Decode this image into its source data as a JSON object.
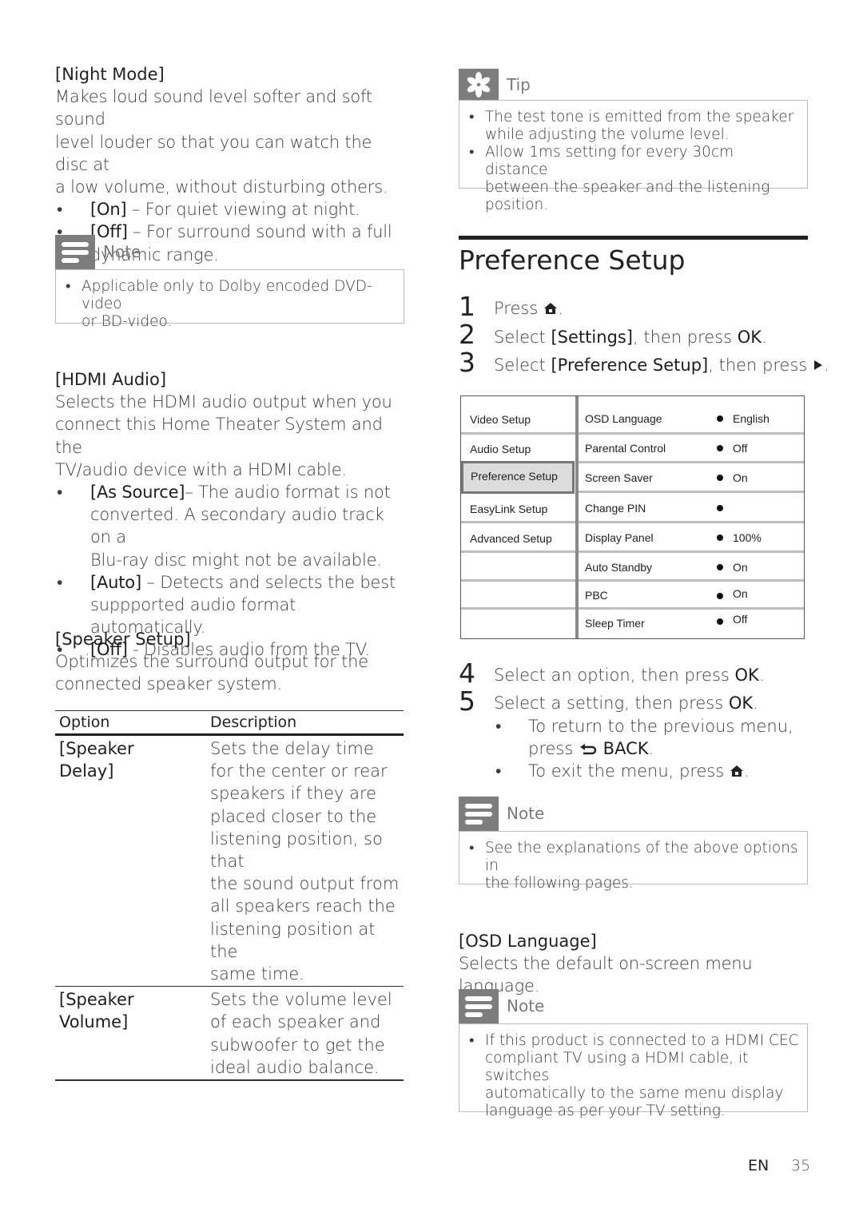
{
  "left_column": {
    "night_mode": {
      "heading": "[Night Mode]",
      "description_lines": [
        "Makes loud sound level softer and soft sound",
        "level louder so that you can watch the disc at",
        "a low volume, without disturbing others."
      ],
      "options": [
        {
          "label": "[On]",
          "text_lines": [
            " – For quiet viewing at night."
          ]
        },
        {
          "label": "[Off]",
          "text_lines": [
            " – For surround sound with a full",
            "dynamic range."
          ]
        }
      ]
    },
    "note_1": {
      "tag": "Note",
      "icon": "note-lines-icon",
      "items": [
        {
          "lines": [
            "Applicable only to Dolby encoded DVD-video",
            "or BD-video."
          ]
        }
      ]
    },
    "hdmi_audio": {
      "heading": "[HDMI Audio]",
      "description_lines": [
        "Selects the HDMI audio output when you",
        "connect this Home Theater System and the",
        "TV/audio device with a HDMI cable."
      ],
      "options": [
        {
          "label": "[As Source]",
          "text_lines": [
            "– The audio format is not",
            "converted. A secondary audio track on a",
            "Blu-ray disc might not be available."
          ]
        },
        {
          "label": "[Auto]",
          "text_lines": [
            " – Detects and selects the best",
            "suppported audio format automatically."
          ]
        },
        {
          "label": "[Off]",
          "text_lines": [
            " - Disables audio from the TV."
          ]
        }
      ]
    },
    "speaker_setup": {
      "heading": "[Speaker Setup]",
      "description_lines": [
        "Optimizes the surround output for the",
        "connected speaker system."
      ],
      "table": {
        "headers": [
          "Option",
          "Description"
        ],
        "rows": [
          {
            "option_lines": [
              "[Speaker",
              "Delay]"
            ],
            "description_lines": [
              "Sets the delay time",
              "for the center or rear",
              "speakers if they are",
              "placed closer to the",
              "listening position, so that",
              "the sound output from",
              "all speakers reach the",
              "listening position at the",
              "same time."
            ]
          },
          {
            "option_lines": [
              "[Speaker",
              "Volume]"
            ],
            "description_lines": [
              "Sets the volume level",
              "of each speaker and",
              "subwoofer to get the",
              "ideal audio balance."
            ]
          }
        ]
      }
    }
  },
  "right_column": {
    "tip": {
      "tag": "Tip",
      "icon": "asterisk-tip-icon",
      "items": [
        {
          "lines": [
            "The test tone is emitted from the speaker",
            "while adjusting the volume level."
          ]
        },
        {
          "lines": [
            "Allow 1ms setting for every 30cm distance",
            "between the speaker and the listening position."
          ]
        }
      ]
    },
    "section_title": "Preference Setup",
    "steps_a": [
      {
        "num": "1",
        "pre": "Press ",
        "icon": "home-icon",
        "bold": "",
        "post": "."
      },
      {
        "num": "2",
        "pre": "Select ",
        "bold": "[Settings]",
        "post": ", then press ",
        "bold2": "OK",
        "post2": "."
      },
      {
        "num": "3",
        "pre": "Select ",
        "bold": "[Preference Setup]",
        "post": ", then press ",
        "icon": "play-right-icon",
        "post2": "."
      }
    ],
    "osd_menu": {
      "left_items": [
        "Video Setup",
        "Audio Setup",
        "Preference Setup",
        "EasyLink Setup",
        "Advanced Setup",
        "",
        "",
        ""
      ],
      "selected_left_index": 2,
      "settings": [
        {
          "name": "OSD Language",
          "value": "English"
        },
        {
          "name": "Parental Control",
          "value": "Off"
        },
        {
          "name": "Screen Saver",
          "value": "On"
        },
        {
          "name": "Change PIN",
          "value": ""
        },
        {
          "name": "Display Panel",
          "value": "100%"
        },
        {
          "name": "Auto Standby",
          "value": "On"
        },
        {
          "name": "PBC",
          "value": "On"
        },
        {
          "name": "Sleep Timer",
          "value": "Off"
        }
      ]
    },
    "steps_b": [
      {
        "num": "4",
        "pre": "Select an option, then press ",
        "bold": "OK",
        "post": "."
      },
      {
        "num": "5",
        "pre": "Select a setting, then press ",
        "bold": "OK",
        "post": "."
      }
    ],
    "step5_bullets": [
      {
        "line1": "To return to the previous menu,",
        "line2_pre": "press ",
        "icon": "back-icon",
        "bold": "BACK",
        "post": "."
      },
      {
        "line1_pre": "To exit the menu, press ",
        "icon": "home-icon",
        "post": "."
      }
    ],
    "note_2": {
      "tag": "Note",
      "icon": "note-lines-icon",
      "items": [
        {
          "lines": [
            "See the explanations of the above options in",
            "the following pages."
          ]
        }
      ]
    },
    "osd_language": {
      "heading": "[OSD Language]",
      "description": "Selects the default on-screen menu language."
    },
    "note_3": {
      "tag": "Note",
      "icon": "note-lines-icon",
      "items": [
        {
          "lines": [
            "If this product is connected to a HDMI CEC",
            "compliant TV using a HDMI cable, it switches",
            "automatically to the same menu display",
            "language as per your TV setting."
          ]
        }
      ]
    }
  },
  "footer": {
    "language": "EN",
    "page_number": "35"
  }
}
